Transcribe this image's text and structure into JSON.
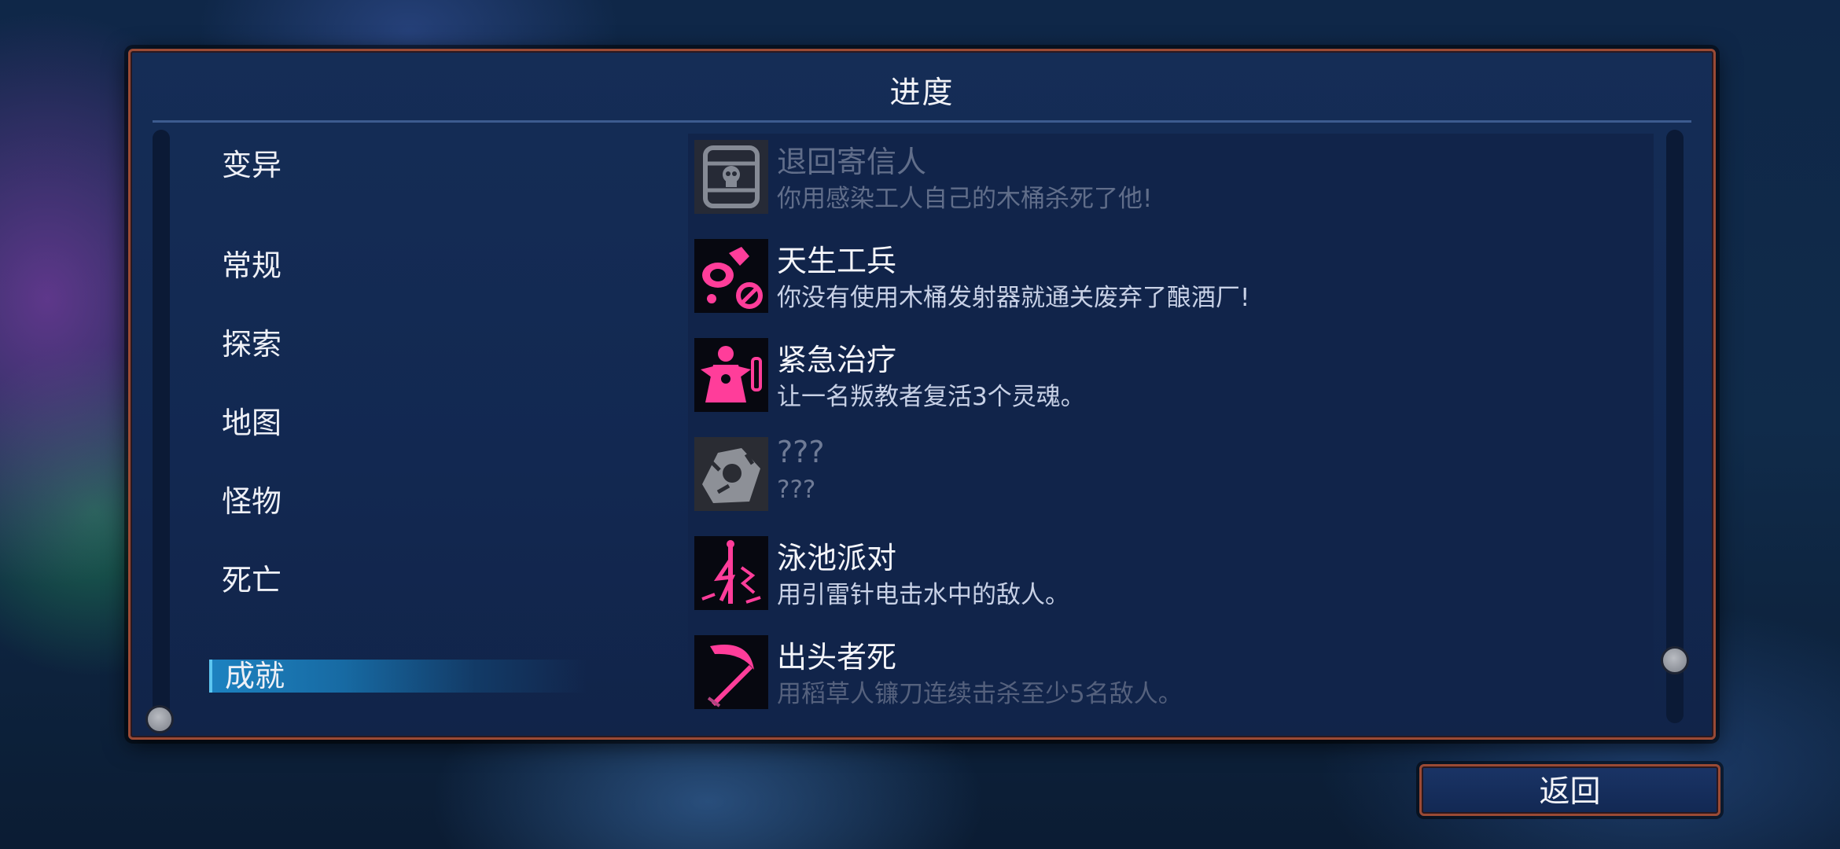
{
  "panel": {
    "title": "进度"
  },
  "menu": {
    "items": [
      {
        "label": "变异"
      },
      {
        "label": "常规"
      },
      {
        "label": "探索"
      },
      {
        "label": "地图"
      },
      {
        "label": "怪物"
      },
      {
        "label": "死亡"
      },
      {
        "label": "成就",
        "selected": true
      }
    ]
  },
  "achievements": [
    {
      "name": "退回寄信人",
      "description": "你用感染工人自己的木桶杀死了他!",
      "icon": "barrel-skull-icon",
      "state": "locked"
    },
    {
      "name": "天生工兵",
      "description": "你没有使用木桶发射器就通关废弃了酿酒厂!",
      "icon": "explosive-barrels-icon",
      "state": "unlocked"
    },
    {
      "name": "紧急治疗",
      "description": "让一名叛教者复活3个灵魂。",
      "icon": "renegade-revive-icon",
      "state": "unlocked"
    },
    {
      "name": "???",
      "description": "???",
      "icon": "hidden-achievement-icon",
      "state": "locked"
    },
    {
      "name": "泳池派对",
      "description": "用引雷针电击水中的敌人。",
      "icon": "lightning-rod-icon",
      "state": "unlocked"
    },
    {
      "name": "出头者死",
      "description": "用稻草人镰刀连续击杀至少5名敌人。",
      "icon": "scythe-icon",
      "state": "unlocked"
    }
  ],
  "footer": {
    "back_label": "返回"
  },
  "colors": {
    "accent": "#e0197a",
    "frame": "#9a4a35",
    "selected_bg": "#1d82c0"
  }
}
